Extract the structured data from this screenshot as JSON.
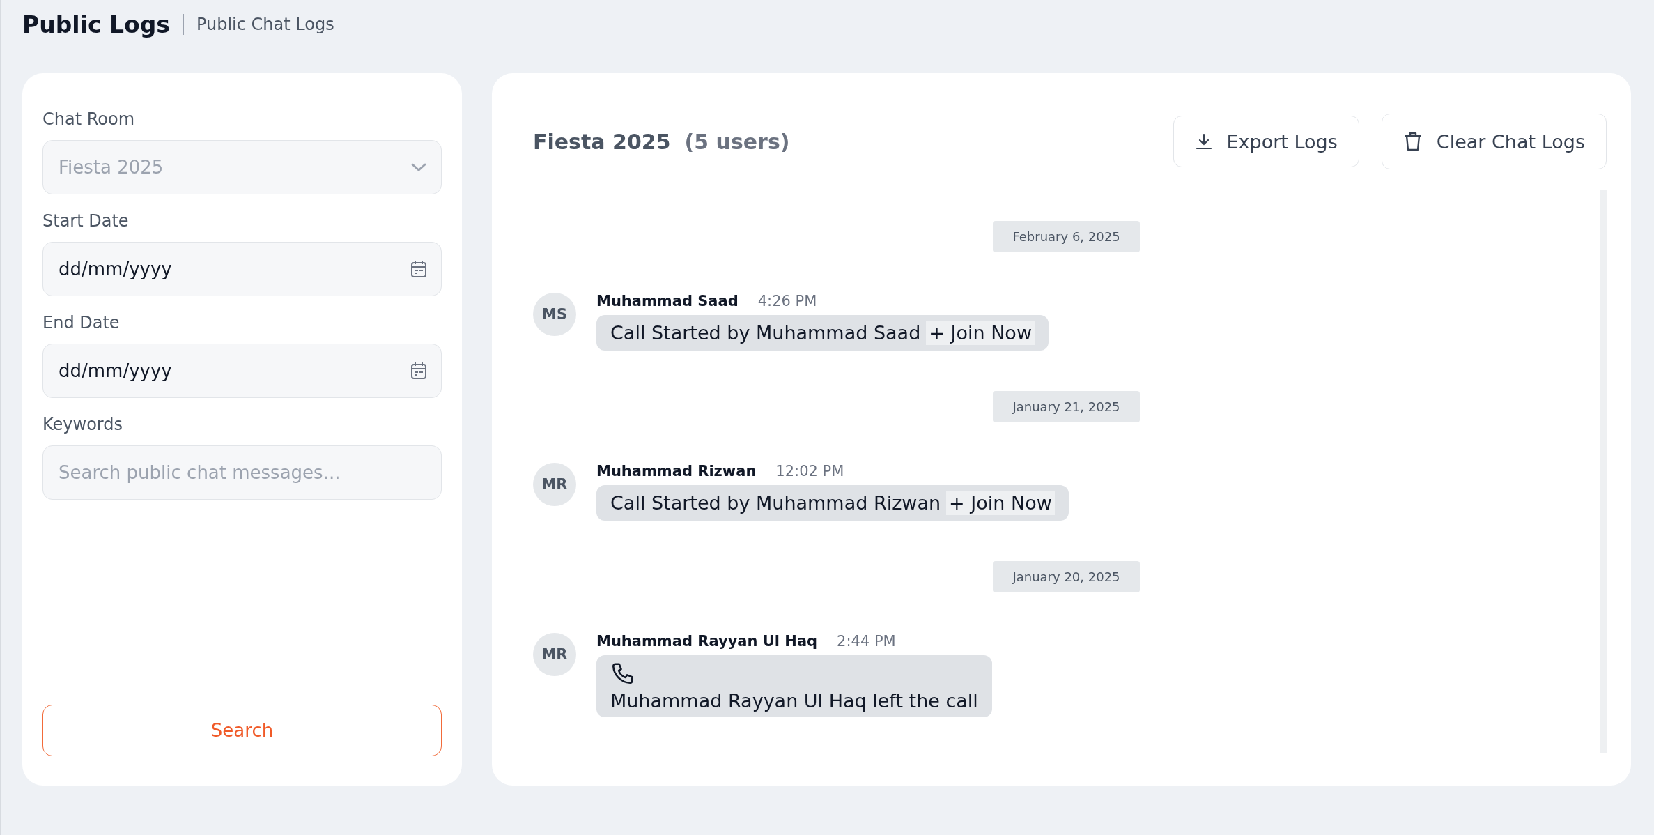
{
  "page": {
    "title": "Public Logs",
    "breadcrumb": "Public Chat Logs"
  },
  "filters": {
    "chat_room": {
      "label": "Chat Room",
      "value": "Fiesta 2025",
      "disabled": true
    },
    "start_date": {
      "label": "Start Date",
      "value": "dd/mm/yyyy"
    },
    "end_date": {
      "label": "End Date",
      "value": "dd/mm/yyyy"
    },
    "keywords": {
      "label": "Keywords",
      "placeholder": "Search public chat messages..."
    },
    "search_button": "Search"
  },
  "chat": {
    "room": "Fiesta 2025",
    "users": "(5 users)",
    "buttons": [
      "Export Logs",
      "Clear Chat Logs"
    ],
    "groups": [
      {
        "date": "February 6, 2025",
        "messages": [
          {
            "initials": "MS",
            "name": "Muhammad Saad",
            "time": "4:26 PM",
            "kind": "call_started",
            "text": "Call Started by Muhammad Saad",
            "link": "+ Join Now"
          }
        ]
      },
      {
        "date": "January 21, 2025",
        "messages": [
          {
            "initials": "MR",
            "name": "Muhammad Rizwan",
            "time": "12:02 PM",
            "kind": "call_started",
            "text": "Call Started by Muhammad Rizwan",
            "link": "+ Join Now"
          }
        ]
      },
      {
        "date": "January 20, 2025",
        "messages": [
          {
            "initials": "MR",
            "name": "Muhammad Rayyan Ul Haq",
            "time": "2:44 PM",
            "kind": "call_left",
            "text": "Muhammad Rayyan Ul Haq left the call"
          }
        ]
      }
    ]
  }
}
